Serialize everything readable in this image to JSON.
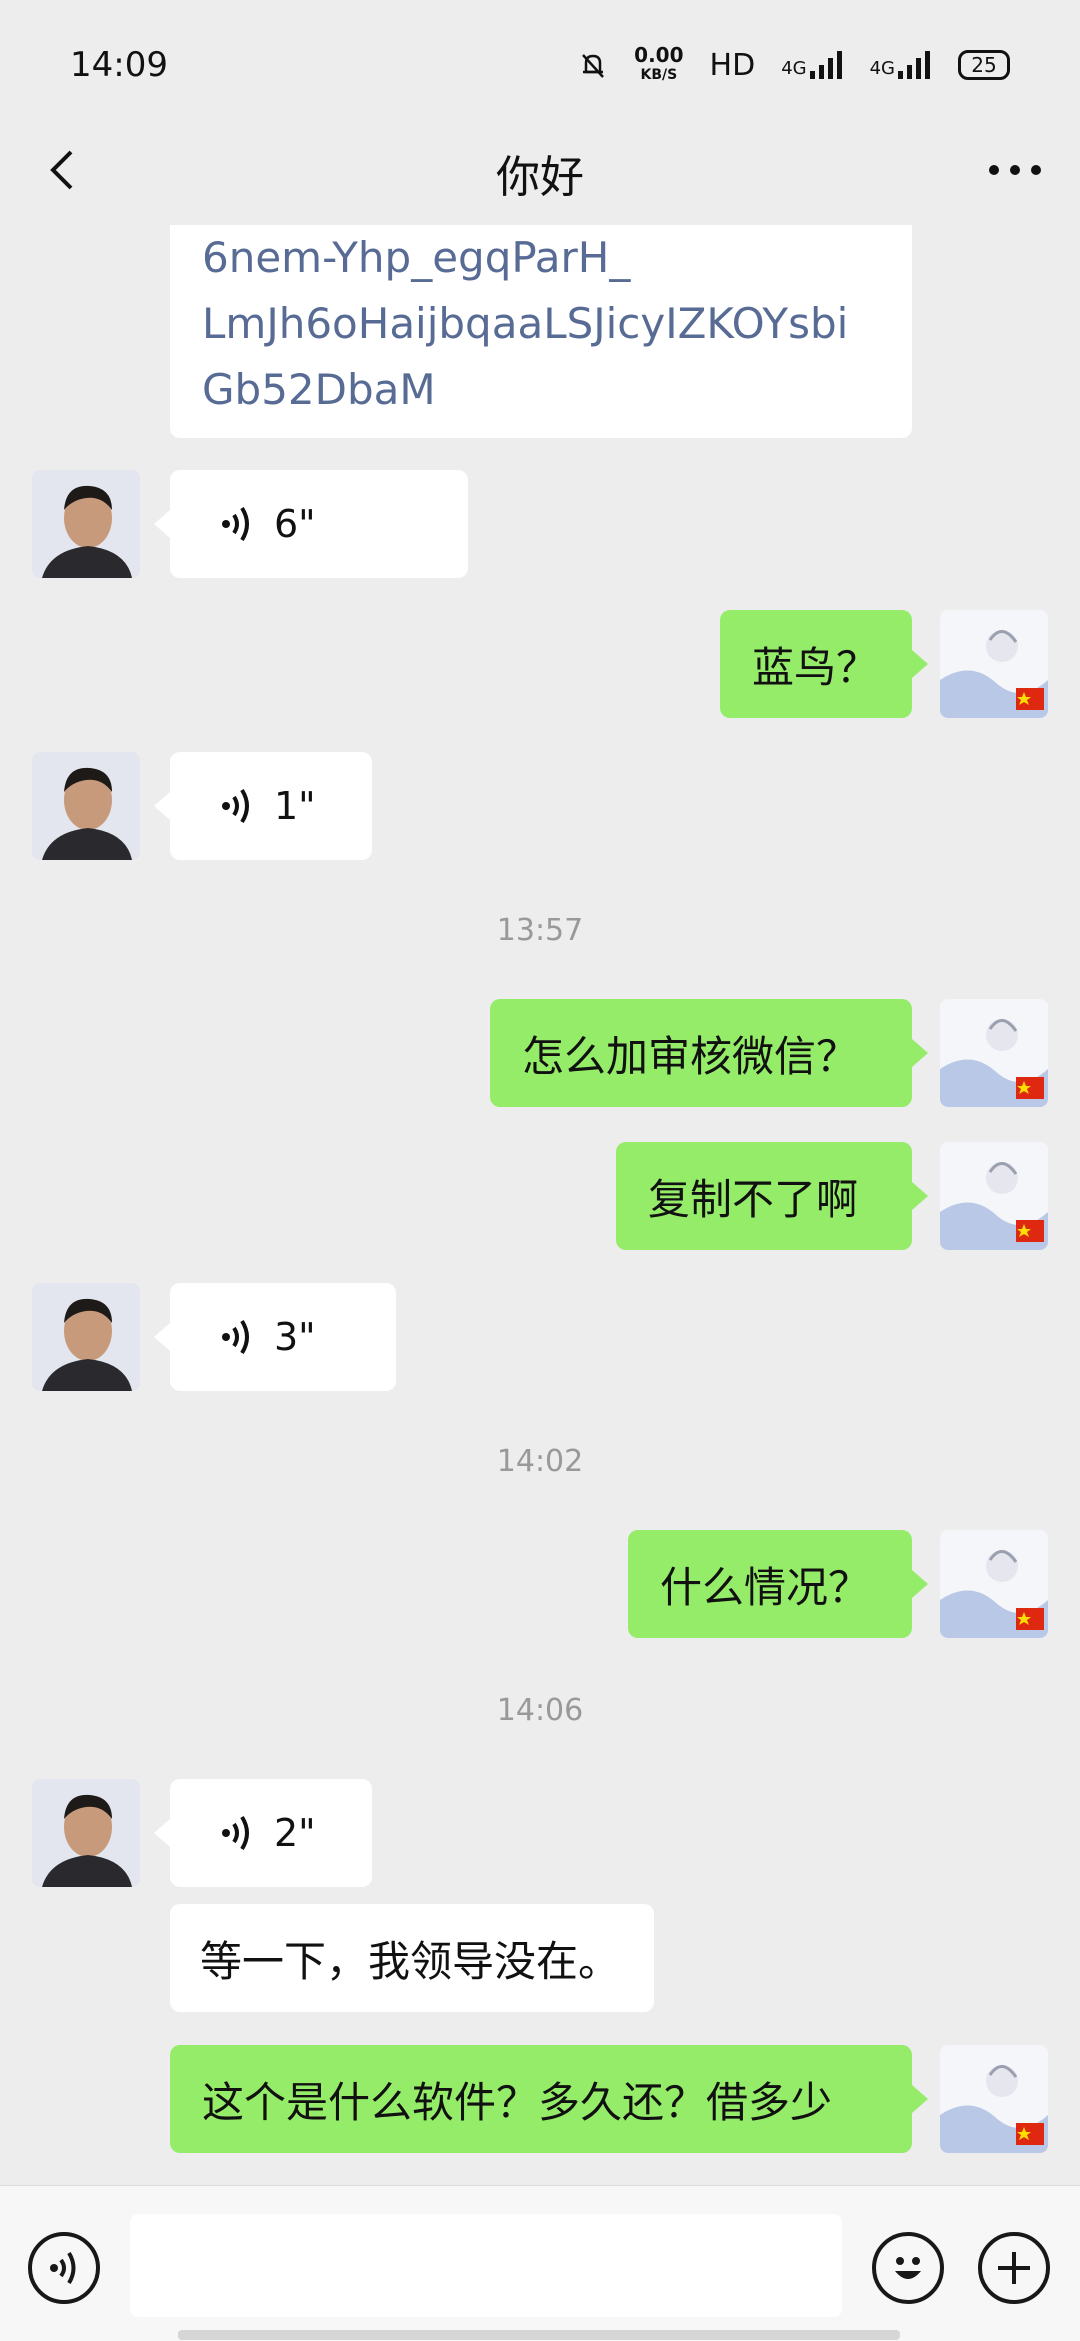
{
  "status_bar": {
    "time": "14:09",
    "net_speed_value": "0.00",
    "net_speed_unit": "KB/S",
    "hd_label": "HD",
    "sim1_label": "4G",
    "sim2_label": "4G",
    "battery": "25"
  },
  "header": {
    "title": "你好",
    "back_icon": "chevron-left-icon",
    "more_icon": "more-dots-icon"
  },
  "messages": {
    "link_lines": [
      "6nem-Yhp_egqParH_",
      "LmJh6oHaijbqaaLSJicyIZKOYsbi",
      "Gb52DbaM"
    ],
    "voice_1": "6\"",
    "text_1": "蓝鸟？",
    "voice_2": "1\"",
    "time_1": "13:57",
    "text_2": "怎么加审核微信？",
    "text_3": "复制不了啊",
    "voice_3": "3\"",
    "time_2": "14:02",
    "text_4": "什么情况？",
    "time_3": "14:06",
    "voice_4": "2\"",
    "text_5": "等一下，我领导没在。",
    "text_6": "这个是什么软件？多久还？借多少"
  },
  "input_bar": {
    "voice_icon": "voice-input-icon",
    "emoji_icon": "emoji-icon",
    "plus_icon": "plus-icon"
  },
  "colors": {
    "background": "#ededed",
    "outgoing_bubble": "#95ec69",
    "incoming_bubble": "#ffffff",
    "link_text": "#576b95"
  }
}
